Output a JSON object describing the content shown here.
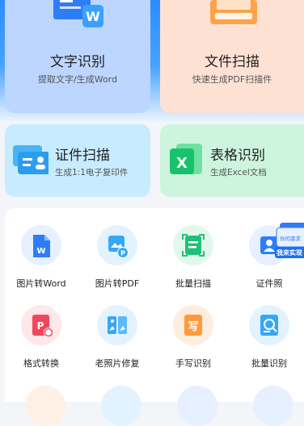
{
  "cards": {
    "ocr": {
      "title": "文字识别",
      "subtitle": "提取文字/生成Word"
    },
    "scan": {
      "title": "文件扫描",
      "subtitle": "快速生成PDF扫描件"
    },
    "id": {
      "title": "证件扫描",
      "subtitle": "生成1:1电子复印件"
    },
    "table": {
      "title": "表格识别",
      "subtitle": "生成Excel文档"
    }
  },
  "tools": [
    {
      "label": "图片转Word"
    },
    {
      "label": "图片转PDF"
    },
    {
      "label": "批量扫描"
    },
    {
      "label": "证件照"
    },
    {
      "label": "格式转换"
    },
    {
      "label": "老照片修复"
    },
    {
      "label": "手写识别"
    },
    {
      "label": "批量识别"
    }
  ],
  "floating": {
    "line1": "你的需求",
    "line2": "我来实现"
  },
  "colors": {
    "accent": "#2f7df6",
    "ocr_card": "#bcd6ff",
    "scan_card": "#fde2d3",
    "id_card": "#c7ecff",
    "table_card": "#cdf5de"
  }
}
